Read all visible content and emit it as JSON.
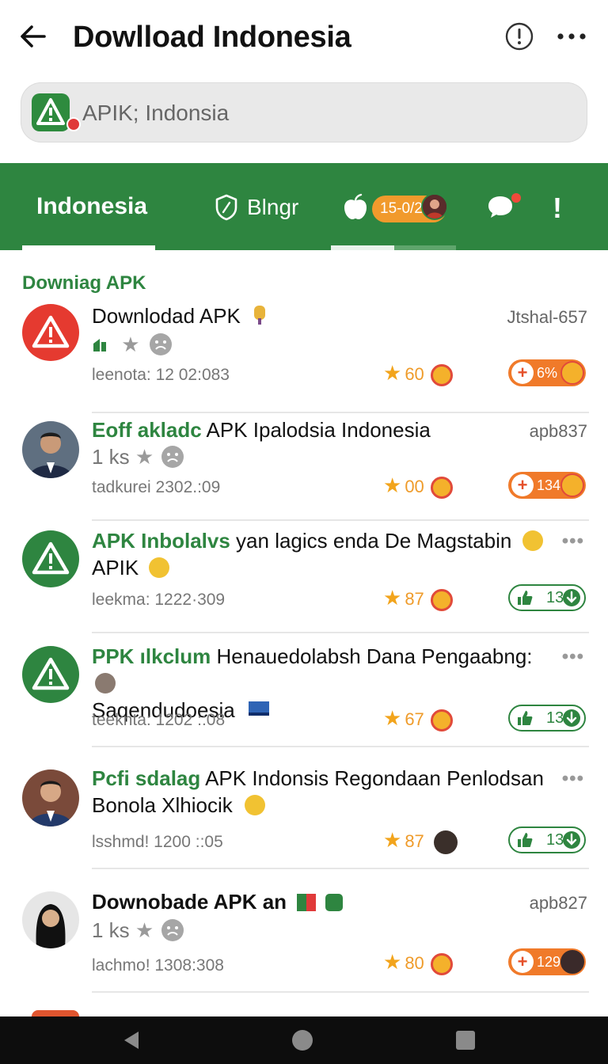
{
  "app_bar": {
    "title": "Dowlload Indonesia",
    "back_icon": "arrow-left-icon",
    "info_icon": "info-circle-icon",
    "more_icon": "more-horizontal-icon"
  },
  "search": {
    "value": "APIK; Indonsia",
    "icon": "app-warning-icon"
  },
  "tabs": [
    {
      "label": "Indonesia",
      "active": true
    },
    {
      "label": "Blngr",
      "icon": "shield-icon"
    },
    {
      "label": "15-0/21",
      "icon": "apple-icon"
    },
    {
      "label": "",
      "icon": "chat-bubble-icon",
      "notification": true
    },
    {
      "label": "!"
    }
  ],
  "section": {
    "title": "Downiag APK"
  },
  "items": [
    {
      "title": "Downlodad APK",
      "title_highlight": "",
      "tag": "Jtshal-657",
      "sub": "",
      "meta": "leenota: 12 02:083",
      "stat": "60",
      "badge": "6%",
      "badge_style": "orange",
      "avatar": "warning-red"
    },
    {
      "title": " APK Ipalodsia Indonesia",
      "title_highlight": "Eoff akladc",
      "tag": "apb837",
      "sub": "1 ks",
      "meta": "tadkurei 2302.:09",
      "stat": "00",
      "badge": "134",
      "badge_style": "orange",
      "avatar": "person-1"
    },
    {
      "title": " yan lagics enda De Magstabin",
      "title_line2": "APIK",
      "title_highlight": "APK Inbolalvs",
      "tag": "",
      "sub": "",
      "meta": "leekma: 1222·309",
      "stat": "87",
      "badge": "136",
      "badge_style": "green",
      "avatar": "warning-green"
    },
    {
      "title": " Henauedolabsh Dana Pengaabng:",
      "title_line2": "Saqendudoesia",
      "title_highlight": "PPK ılkclum",
      "tag": "",
      "sub": "",
      "meta": "teeknta: 1202 ::08",
      "stat": "67",
      "badge": "136",
      "badge_style": "green",
      "avatar": "warning-green"
    },
    {
      "title": " APK Indonsis Regondaan Penlodsan",
      "title_line2": "Bonola Xlhiocik",
      "title_highlight": "Pcfi sdalag",
      "tag": "",
      "sub": "",
      "meta": "lsshmd! 1200 ::05",
      "stat": "87",
      "badge": "136",
      "badge_style": "green",
      "avatar": "person-2"
    },
    {
      "title": "Downobade APK an",
      "title_highlight": "",
      "tag": "apb827",
      "sub": "1 ks",
      "meta": "lachmo! 1308:308",
      "stat": "80",
      "badge": "129",
      "badge_style": "orange",
      "avatar": "person-3"
    }
  ],
  "nav": {
    "back_icon": "nav-back-icon",
    "home_icon": "nav-home-icon",
    "recent_icon": "nav-recent-icon"
  },
  "colors": {
    "primary_green": "#2e8540",
    "warning_red": "#e53a30",
    "accent_orange": "#f07a2a",
    "star": "#f2a41c"
  }
}
